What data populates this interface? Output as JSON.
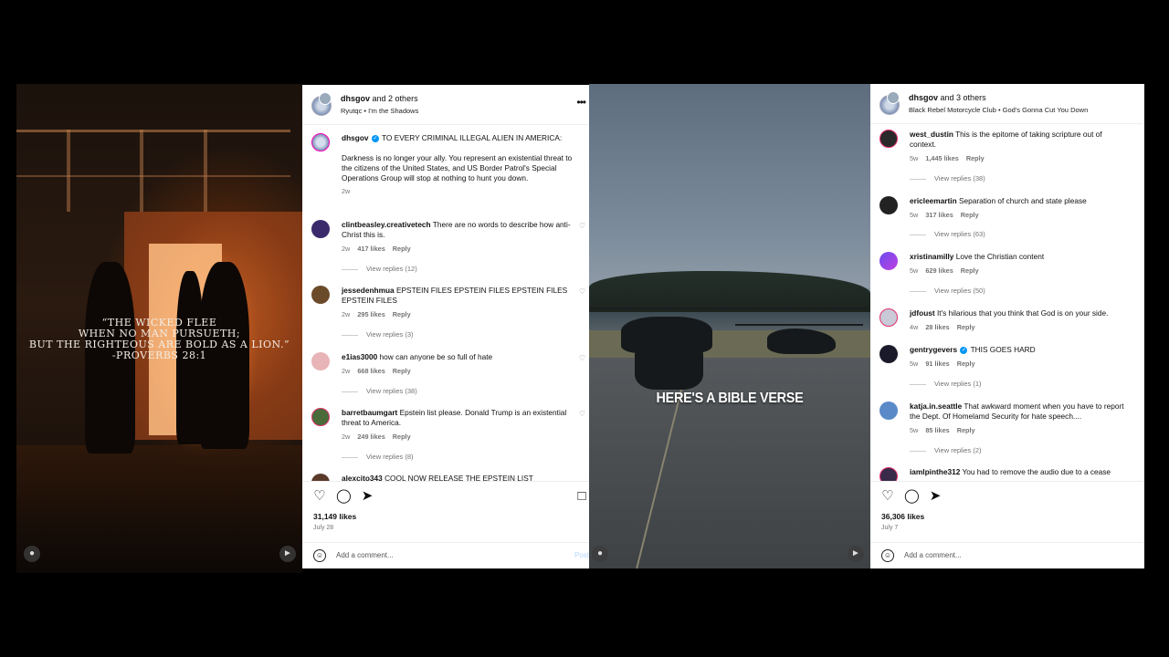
{
  "left_video": {
    "verse_lines": [
      "“THE WICKED FLEE",
      "WHEN NO MAN PURSUETH;",
      "BUT THE RIGHTEOUS ARE BOLD AS A LION.”",
      "-PROVERBS 28:1"
    ]
  },
  "right_video": {
    "overlay_text": "HERE'S A BIBLE VERSE"
  },
  "post1": {
    "header": {
      "authors": "dhsgov",
      "and_others": "and 2 others",
      "audio": "Ryutqc • I'm the Shadows",
      "more": "•••"
    },
    "caption": {
      "username": "dhsgov",
      "headline": "TO EVERY CRIMINAL ILLEGAL ALIEN IN AMERICA:",
      "body": "Darkness is no longer your ally. You represent an existential threat to the citizens of the United States, and US Border Patrol's Special Operations Group will stop at nothing to hunt you down.",
      "time": "2w"
    },
    "comments": [
      {
        "username": "clintbeasley.creativetech",
        "text": "There are no words to describe how anti-Christ this is.",
        "time": "2w",
        "likes": "417 likes",
        "reply": "Reply",
        "view_replies": "View replies (12)"
      },
      {
        "username": "jessedenhmua",
        "text": "EPSTEIN FILES EPSTEIN FILES EPSTEIN FILES EPSTEIN FILES",
        "time": "2w",
        "likes": "295 likes",
        "reply": "Reply",
        "view_replies": "View replies (3)"
      },
      {
        "username": "e1ias3000",
        "text": "how can anyone be so full of hate",
        "time": "2w",
        "likes": "668 likes",
        "reply": "Reply",
        "view_replies": "View replies (38)"
      },
      {
        "username": "barretbaumgart",
        "text": "Epstein list please. Donald Trump is an existential threat to America.",
        "time": "2w",
        "likes": "249 likes",
        "reply": "Reply",
        "view_replies": "View replies (8)"
      },
      {
        "username": "alexcito343",
        "text": "COOL NOW RELEASE THE EPSTEIN LIST"
      }
    ],
    "likes": "31,149 likes",
    "date": "July 28",
    "add_comment_placeholder": "Add a comment...",
    "post_label": "Post"
  },
  "post2": {
    "header": {
      "authors": "dhsgov",
      "and_others": "and 3 others",
      "audio": "Black Rebel Motorcycle Club • God's Gonna Cut You Down"
    },
    "comments": [
      {
        "username": "west_dustin",
        "text": "This is the epitome of taking scripture out of context.",
        "time": "5w",
        "likes": "1,445 likes",
        "reply": "Reply",
        "view_replies": "View replies (38)"
      },
      {
        "username": "ericleemartin",
        "text": "Separation of church and state please",
        "time": "5w",
        "likes": "317 likes",
        "reply": "Reply",
        "view_replies": "View replies (63)"
      },
      {
        "username": "xristinamilly",
        "text": "Love the Christian content",
        "time": "5w",
        "likes": "629 likes",
        "reply": "Reply",
        "view_replies": "View replies (50)"
      },
      {
        "username": "jdfoust",
        "text": "It's hilarious that you think that God is on your side.",
        "time": "4w",
        "likes": "28 likes",
        "reply": "Reply"
      },
      {
        "username": "gentrygevers",
        "text": "THIS GOES HARD",
        "time": "5w",
        "likes": "91 likes",
        "reply": "Reply",
        "view_replies": "View replies (1)"
      },
      {
        "username": "katja.in.seattle",
        "text": "That awkward moment when you have to report the Dept. Of Homelamd Security for hate speech....",
        "time": "5w",
        "likes": "85 likes",
        "reply": "Reply",
        "view_replies": "View replies (2)"
      },
      {
        "username": "iamlpinthe312",
        "text": "You had to remove the audio due to a cease"
      }
    ],
    "likes": "36,306 likes",
    "date": "July 7",
    "add_comment_placeholder": "Add a comment..."
  }
}
